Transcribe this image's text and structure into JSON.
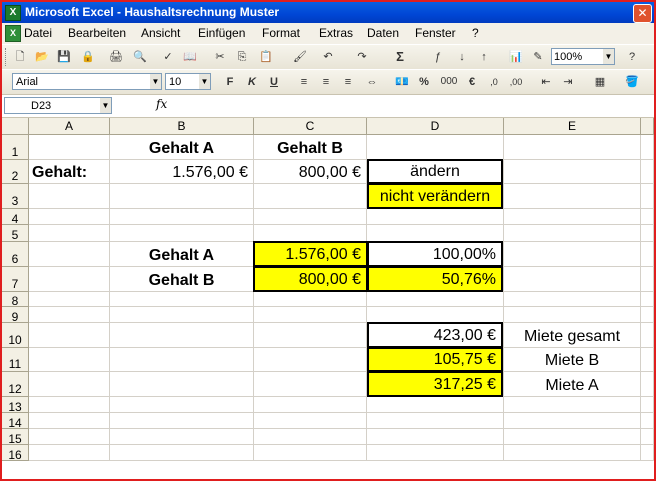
{
  "window": {
    "title": "Microsoft Excel - Haushaltsrechnung Muster",
    "app_icon": "X"
  },
  "menu": [
    "Datei",
    "Bearbeiten",
    "Ansicht",
    "Einfügen",
    "Format",
    "Extras",
    "Daten",
    "Fenster",
    "?"
  ],
  "toolbar": {
    "zoom": "100%",
    "font_name": "Arial",
    "font_size": "10",
    "bold": "F",
    "italic": "K",
    "underline": "U",
    "percent": "%",
    "thousands": "000",
    "euro": "€",
    "sum": "Σ"
  },
  "formula_bar": {
    "cell_ref": "D23",
    "fx_label": "fx",
    "content": ""
  },
  "columns": [
    "A",
    "B",
    "C",
    "D",
    "E"
  ],
  "rows": [
    "1",
    "2",
    "3",
    "4",
    "5",
    "6",
    "7",
    "8",
    "9",
    "10",
    "11",
    "12",
    "13",
    "14",
    "15",
    "16"
  ],
  "cells": {
    "B1": "Gehalt A",
    "C1": "Gehalt B",
    "A2": "Gehalt:",
    "B2": "1.576,00 €",
    "C2": "800,00 €",
    "D2": "ändern",
    "D3": "nicht verändern",
    "B6": "Gehalt A",
    "C6": "1.576,00 €",
    "D6": "100,00%",
    "B7": "Gehalt B",
    "C7": "800,00 €",
    "D7": "50,76%",
    "D10": "423,00 €",
    "E10": "Miete gesamt",
    "D11": "105,75 €",
    "E11": "Miete B",
    "D12": "317,25 €",
    "E12": "Miete A"
  },
  "colors": {
    "highlight": "#ffff00",
    "title_bar": "#0046d5",
    "frame": "#e01e1e"
  }
}
